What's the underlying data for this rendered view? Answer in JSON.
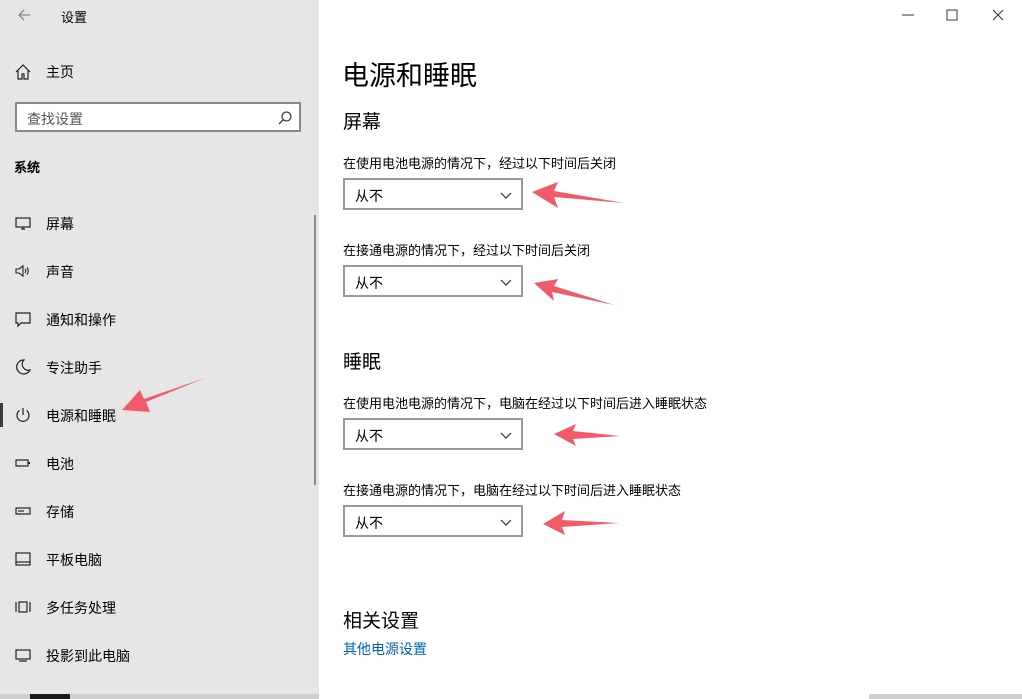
{
  "window": {
    "app_title": "设置",
    "icons": {
      "back": "back-arrow-icon",
      "minimize": "minimize-icon",
      "maximize": "maximize-icon",
      "close": "close-icon"
    }
  },
  "sidebar": {
    "home_label": "主页",
    "search_placeholder": "查找设置",
    "section_label": "系统",
    "items": [
      {
        "label": "屏幕",
        "icon": "display-icon"
      },
      {
        "label": "声音",
        "icon": "speaker-icon"
      },
      {
        "label": "通知和操作",
        "icon": "notification-icon"
      },
      {
        "label": "专注助手",
        "icon": "moon-icon"
      },
      {
        "label": "电源和睡眠",
        "icon": "power-icon",
        "active": true
      },
      {
        "label": "电池",
        "icon": "battery-icon"
      },
      {
        "label": "存储",
        "icon": "storage-icon"
      },
      {
        "label": "平板电脑",
        "icon": "tablet-icon"
      },
      {
        "label": "多任务处理",
        "icon": "multitask-icon"
      },
      {
        "label": "投影到此电脑",
        "icon": "project-icon"
      }
    ]
  },
  "main": {
    "title": "电源和睡眠",
    "screen": {
      "heading": "屏幕",
      "battery_desc": "在使用电池电源的情况下，经过以下时间后关闭",
      "battery_value": "从不",
      "plugged_desc": "在接通电源的情况下，经过以下时间后关闭",
      "plugged_value": "从不"
    },
    "sleep": {
      "heading": "睡眠",
      "battery_desc": "在使用电池电源的情况下，电脑在经过以下时间后进入睡眠状态",
      "battery_value": "从不",
      "plugged_desc": "在接通电源的情况下，电脑在经过以下时间后进入睡眠状态",
      "plugged_value": "从不"
    },
    "related": {
      "heading": "相关设置",
      "link": "其他电源设置"
    }
  },
  "colors": {
    "annotation_arrow": "#f25a6a",
    "link": "#0063b1",
    "sidebar_bg": "#e6e6e6"
  }
}
